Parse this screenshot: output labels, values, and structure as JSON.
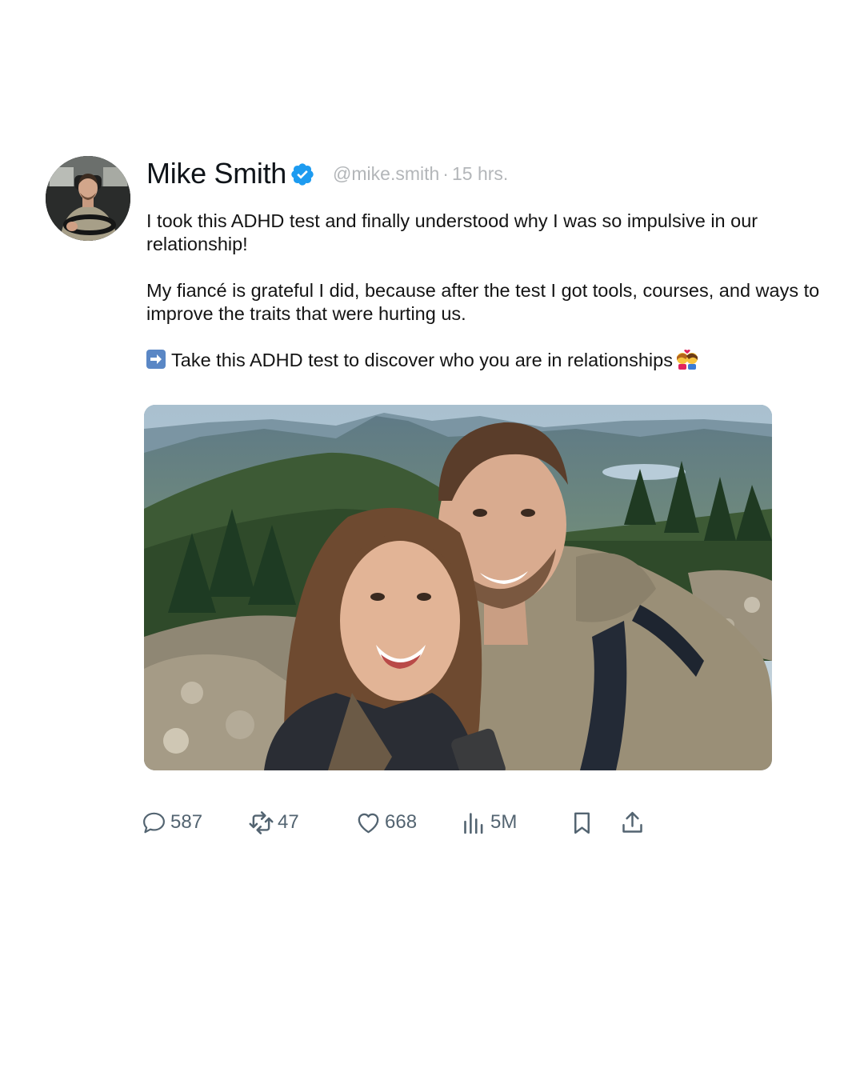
{
  "post": {
    "author_name": "Mike Smith",
    "handle": "@mike.smith",
    "separator": "·",
    "time": "15 hrs.",
    "verified": true,
    "body": {
      "paragraph_1": "I took this ADHD test and finally understood why I was so impulsive in our relationship!",
      "paragraph_2": "My fiancé is grateful I did, because after the test I got tools, courses, and ways to improve the traits that were hurting us.",
      "paragraph_3": "Take this ADHD test to discover who you are in relationships"
    },
    "stats": {
      "replies": "587",
      "reposts": "47",
      "likes": "668",
      "views": "5M"
    }
  },
  "icons": {
    "verified": "verified-badge-icon",
    "arrow": "right-arrow-emoji-icon",
    "kiss": "couple-kiss-emoji-icon",
    "reply": "reply-icon",
    "repost": "repost-icon",
    "like": "heart-icon",
    "views": "views-chart-icon",
    "bookmark": "bookmark-icon",
    "share": "share-icon"
  },
  "colors": {
    "verified_blue": "#1d9bf0",
    "muted_text": "#b3b6b9",
    "action_gray": "#536471"
  }
}
